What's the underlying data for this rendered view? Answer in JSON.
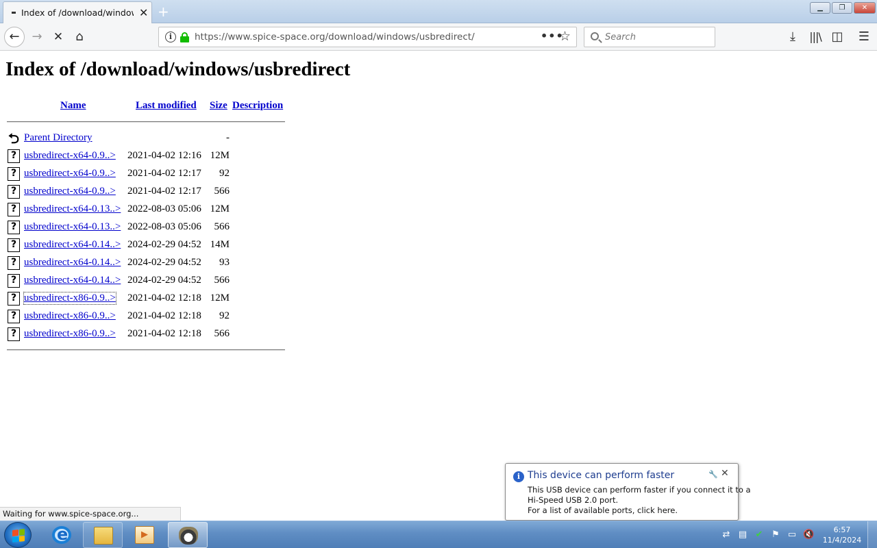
{
  "browser": {
    "tab_title": "Index of /download/windows/usbredirect",
    "new_tab_glyph": "+",
    "url_scheme": "https://www.",
    "url_host": "spice-space.org",
    "url_path": "/download/windows/usbredirect/",
    "search_placeholder": "Search",
    "status_text": "Waiting for www.spice-space.org...",
    "icons": [
      "back-icon",
      "forward-icon",
      "stop-icon",
      "home-icon",
      "info-icon",
      "lock-icon",
      "page-actions-icon",
      "bookmark-star-icon",
      "search-icon",
      "download-icon",
      "library-icon",
      "sidebar-icon",
      "menu-icon"
    ]
  },
  "page": {
    "title": "Index of /download/windows/usbredirect",
    "headers": {
      "name": "Name",
      "last_modified": "Last modified",
      "size": "Size",
      "description": "Description"
    },
    "parent": {
      "name": "Parent Directory",
      "size": "-"
    },
    "rows": [
      {
        "name": "usbredirect-x64-0.9..>",
        "date": "2021-04-02 12:16",
        "size": "12M"
      },
      {
        "name": "usbredirect-x64-0.9..>",
        "date": "2021-04-02 12:17",
        "size": "92"
      },
      {
        "name": "usbredirect-x64-0.9..>",
        "date": "2021-04-02 12:17",
        "size": "566"
      },
      {
        "name": "usbredirect-x64-0.13..>",
        "date": "2022-08-03 05:06",
        "size": "12M"
      },
      {
        "name": "usbredirect-x64-0.13..>",
        "date": "2022-08-03 05:06",
        "size": "566"
      },
      {
        "name": "usbredirect-x64-0.14..>",
        "date": "2024-02-29 04:52",
        "size": "14M"
      },
      {
        "name": "usbredirect-x64-0.14..>",
        "date": "2024-02-29 04:52",
        "size": "93"
      },
      {
        "name": "usbredirect-x64-0.14..>",
        "date": "2024-02-29 04:52",
        "size": "566"
      },
      {
        "name": "usbredirect-x86-0.9..>",
        "date": "2021-04-02 12:18",
        "size": "12M"
      },
      {
        "name": "usbredirect-x86-0.9..>",
        "date": "2021-04-02 12:18",
        "size": "92"
      },
      {
        "name": "usbredirect-x86-0.9..>",
        "date": "2021-04-02 12:18",
        "size": "566"
      }
    ]
  },
  "notification": {
    "title": "This device can perform faster",
    "line1": "This USB device can perform faster if you connect it to a",
    "line2": "Hi-Speed USB 2.0 port.",
    "line3": "For a list of available ports, click here."
  },
  "taskbar": {
    "time": "6:57",
    "date": "11/4/2024",
    "tray_icons": [
      "usb-icon",
      "network-icon",
      "security-icon",
      "flag-icon",
      "monitor-icon",
      "volume-muted-icon"
    ]
  },
  "colors": {
    "link": "#0000cc",
    "lock_green": "#12bc00",
    "taskbar": "#5f8dc3",
    "balloon_title": "#1e3d8f"
  }
}
